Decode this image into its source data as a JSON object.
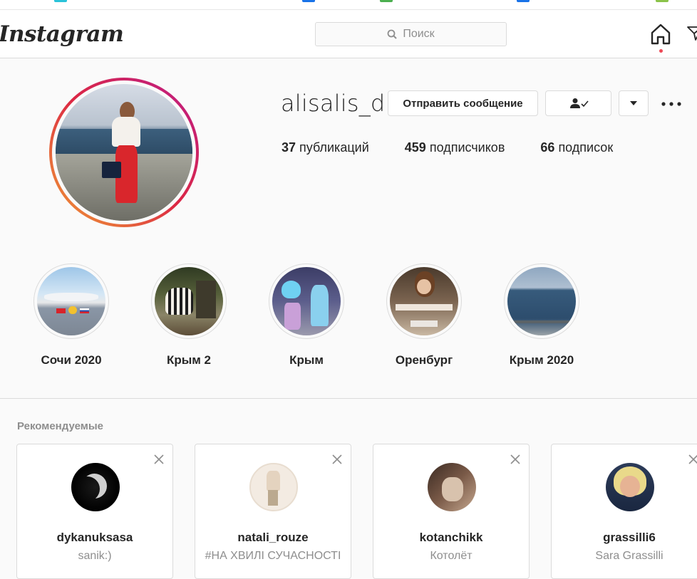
{
  "browser": {
    "marks": [
      {
        "color": "#2bc3d9"
      },
      {
        "color": "#1a73e8"
      },
      {
        "color": "#4caf50"
      },
      {
        "color": "#1a73e8"
      },
      {
        "color": "#8bc34a"
      },
      {
        "color": "#888888"
      }
    ]
  },
  "nav": {
    "logo": "Instagram",
    "search_placeholder": "Поиск"
  },
  "profile": {
    "username": "alisalis_d",
    "message_button": "Отправить сообщение",
    "stats": [
      {
        "value": "37",
        "label": "публикаций"
      },
      {
        "value": "459",
        "label": "подписчиков"
      },
      {
        "value": "66",
        "label": "подписок"
      }
    ]
  },
  "highlights": [
    {
      "label": "Сочи 2020"
    },
    {
      "label": "Крым 2"
    },
    {
      "label": "Крым"
    },
    {
      "label": "Оренбург"
    },
    {
      "label": "Крым 2020"
    }
  ],
  "suggested": {
    "title": "Рекомендуемые",
    "cards": [
      {
        "name": "dykanuksasa",
        "subtitle": "sanik:)"
      },
      {
        "name": "natali_rouze",
        "subtitle": "#НА ХВИЛІ СУЧАСНОСТІ"
      },
      {
        "name": "kotanchikk",
        "subtitle": "Котолёт"
      },
      {
        "name": "grassilli6",
        "subtitle": "Sara Grassilli"
      }
    ]
  },
  "colors": {
    "accent": "#262626",
    "notification": "#ed4956",
    "story_gradient": [
      "#f09433",
      "#dc2743",
      "#bc1888"
    ]
  }
}
